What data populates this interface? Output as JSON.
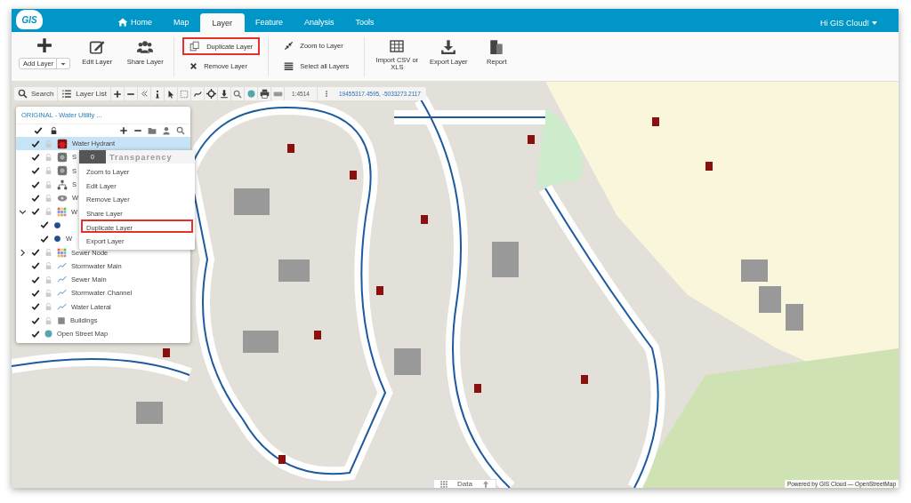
{
  "header": {
    "logo": "GIS",
    "tabs": [
      {
        "label": "Home",
        "selected": false
      },
      {
        "label": "Map",
        "selected": false
      },
      {
        "label": "Layer",
        "selected": true
      },
      {
        "label": "Feature",
        "selected": false
      },
      {
        "label": "Analysis",
        "selected": false
      },
      {
        "label": "Tools",
        "selected": false
      }
    ],
    "user_menu": "Hi GIS Cloud!"
  },
  "ribbon": {
    "groups": [
      {
        "kind": "large",
        "buttons": [
          {
            "kind": "dropdown",
            "label": "Add Layer"
          },
          {
            "kind": "large",
            "label": "Edit Layer"
          },
          {
            "kind": "large",
            "label": "Share Layer"
          }
        ]
      },
      {
        "kind": "small",
        "buttons": [
          {
            "kind": "small",
            "label": "Duplicate Layer",
            "highlighted": true
          },
          {
            "kind": "small",
            "label": "Remove Layer",
            "highlighted": false
          }
        ]
      },
      {
        "kind": "small",
        "buttons": [
          {
            "kind": "small",
            "label": "Zoom to Layer",
            "highlighted": false
          },
          {
            "kind": "small",
            "label": "Select all Layers",
            "highlighted": false
          }
        ]
      },
      {
        "kind": "large",
        "buttons": [
          {
            "kind": "large",
            "label": "Import CSV or XLS"
          },
          {
            "kind": "large",
            "label": "Export Layer"
          },
          {
            "kind": "large",
            "label": "Report"
          }
        ]
      }
    ]
  },
  "map": {
    "toolbar": {
      "search": "Search",
      "layer_list": "Layer List",
      "scale": "1:4514",
      "coordinates": "19455317.4595, -5033273.2117"
    },
    "layer_panel": {
      "title": "ORIGINAL - Water Utility ...",
      "layers": [
        {
          "name": "Water Hydrant",
          "kind": "hydrant",
          "checked": true,
          "selected": true
        },
        {
          "name": "S",
          "kind": "manhole",
          "checked": true,
          "selected": false
        },
        {
          "name": "S",
          "kind": "manhole",
          "checked": true,
          "selected": false
        },
        {
          "name": "S",
          "kind": "network",
          "checked": true,
          "selected": false
        },
        {
          "name": "W",
          "kind": "valve",
          "checked": true,
          "selected": false
        },
        {
          "name": "W",
          "kind": "graduated",
          "checked": true,
          "selected": false,
          "expanded": true,
          "children": [
            {
              "kind": "dot",
              "checked": true,
              "selected": false
            },
            {
              "name": "W",
              "kind": "dot",
              "checked": true,
              "selected": false
            }
          ]
        },
        {
          "name": "Sewer Node",
          "kind": "graduated",
          "checked": true,
          "selected": false,
          "expanded": false
        },
        {
          "name": "Stormwater Main",
          "kind": "line",
          "checked": true,
          "selected": false
        },
        {
          "name": "Sewer Main",
          "kind": "line",
          "checked": true,
          "selected": false
        },
        {
          "name": "Stormwater Channel",
          "kind": "line",
          "checked": true,
          "selected": false
        },
        {
          "name": "Water Lateral",
          "kind": "line",
          "checked": true,
          "selected": false
        },
        {
          "name": "Buildings",
          "kind": "square",
          "checked": true,
          "selected": false
        },
        {
          "name": "Open Street Map",
          "kind": "globe",
          "checked": true,
          "selected": false
        }
      ]
    },
    "context_menu": {
      "transparency_value": "0",
      "transparency_label": "Transparency",
      "level": 0,
      "items": [
        {
          "label": "Zoom to Layer",
          "highlighted": false
        },
        {
          "label": "Edit Layer",
          "highlighted": false
        },
        {
          "label": "Remove Layer",
          "highlighted": false
        },
        {
          "label": "Share Layer",
          "highlighted": false
        },
        {
          "label": "Duplicate Layer",
          "highlighted": true
        },
        {
          "label": "Export Layer",
          "highlighted": false
        }
      ]
    },
    "data_tab": "Data",
    "attribution": "Powered by GIS Cloud — OpenStreetMap"
  }
}
